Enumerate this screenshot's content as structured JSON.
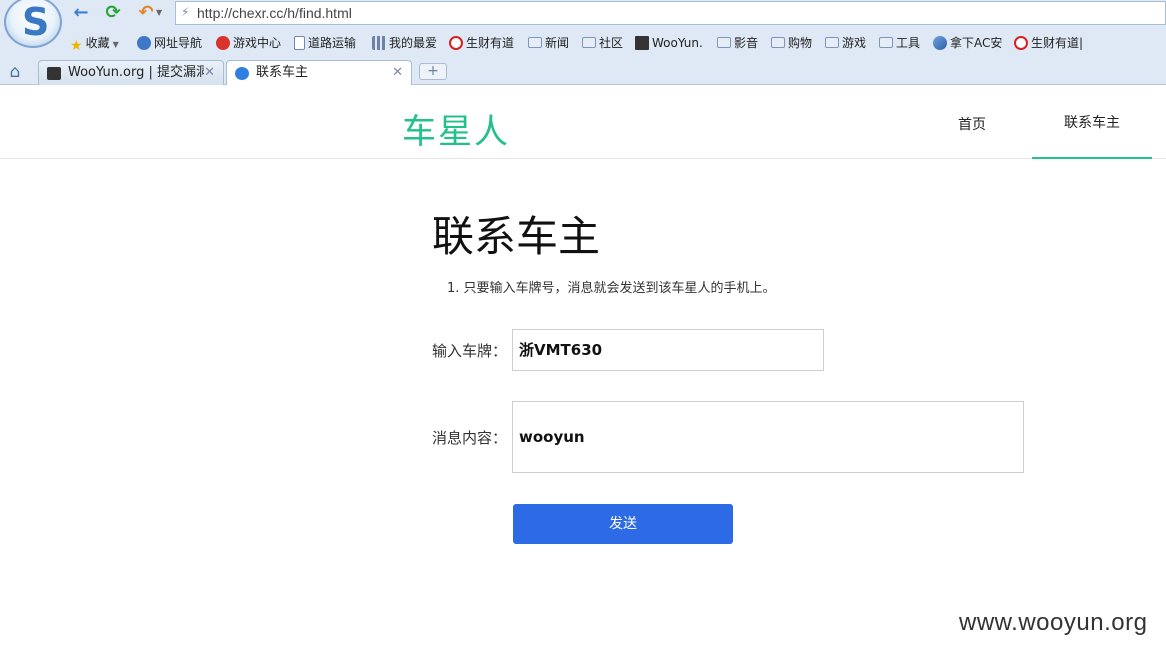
{
  "browser": {
    "url": "http://chexr.cc/h/find.html",
    "bookmarks": [
      {
        "label": "收藏",
        "icon": "star-icon"
      },
      {
        "label": "网址导航",
        "icon": "swirl-icon"
      },
      {
        "label": "游戏中心",
        "icon": "game-icon"
      },
      {
        "label": "道路运输",
        "icon": "page-icon"
      },
      {
        "label": "我的最爱",
        "icon": "grid-icon"
      },
      {
        "label": "生财有道",
        "icon": "no-sign-icon"
      },
      {
        "label": "新闻",
        "icon": "folder-icon"
      },
      {
        "label": "社区",
        "icon": "folder-icon"
      },
      {
        "label": "WooYun.",
        "icon": "wooyun-icon"
      },
      {
        "label": "影音",
        "icon": "folder-icon"
      },
      {
        "label": "购物",
        "icon": "folder-icon"
      },
      {
        "label": "游戏",
        "icon": "folder-icon"
      },
      {
        "label": "工具",
        "icon": "folder-icon"
      },
      {
        "label": "拿下AC安",
        "icon": "ac-icon"
      },
      {
        "label": "生财有道|",
        "icon": "no-sign-icon"
      }
    ],
    "tabs": [
      {
        "title": "WooYun.org | 提交漏洞"
      },
      {
        "title": "联系车主"
      }
    ],
    "new_tab_label": "+"
  },
  "site": {
    "brand": "车星人",
    "nav": {
      "home": "首页",
      "contact": "联系车主"
    }
  },
  "page": {
    "title": "联系车主",
    "tip": "1. 只要输入车牌号，消息就会发送到该车星人的手机上。",
    "plate_label": "输入车牌：",
    "plate_value": "浙VMT630",
    "message_label": "消息内容：",
    "message_value": "wooyun",
    "send_label": "发送"
  },
  "watermark": "www.wooyun.org"
}
